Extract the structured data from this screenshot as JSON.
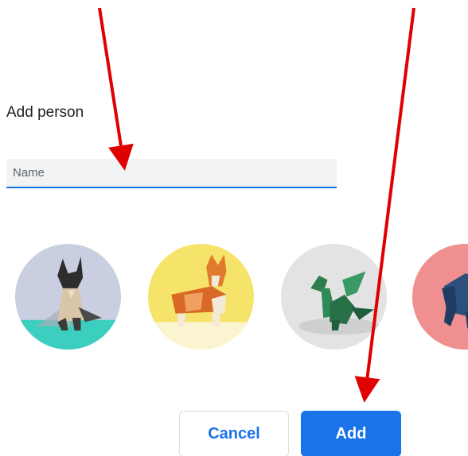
{
  "dialog": {
    "title": "Add person",
    "name_input": {
      "placeholder": "Name",
      "value": ""
    },
    "avatars": [
      {
        "name": "cat-avatar",
        "bg": "#c9cfe0"
      },
      {
        "name": "corgi-avatar",
        "bg": "#f6e46a"
      },
      {
        "name": "dragon-avatar",
        "bg": "#e3e3e3"
      },
      {
        "name": "elephant-avatar",
        "bg": "#ef8f8f"
      }
    ],
    "buttons": {
      "cancel_label": "Cancel",
      "add_label": "Add"
    }
  },
  "colors": {
    "accent": "#1a73e8",
    "annotation_arrow": "#e00000"
  }
}
